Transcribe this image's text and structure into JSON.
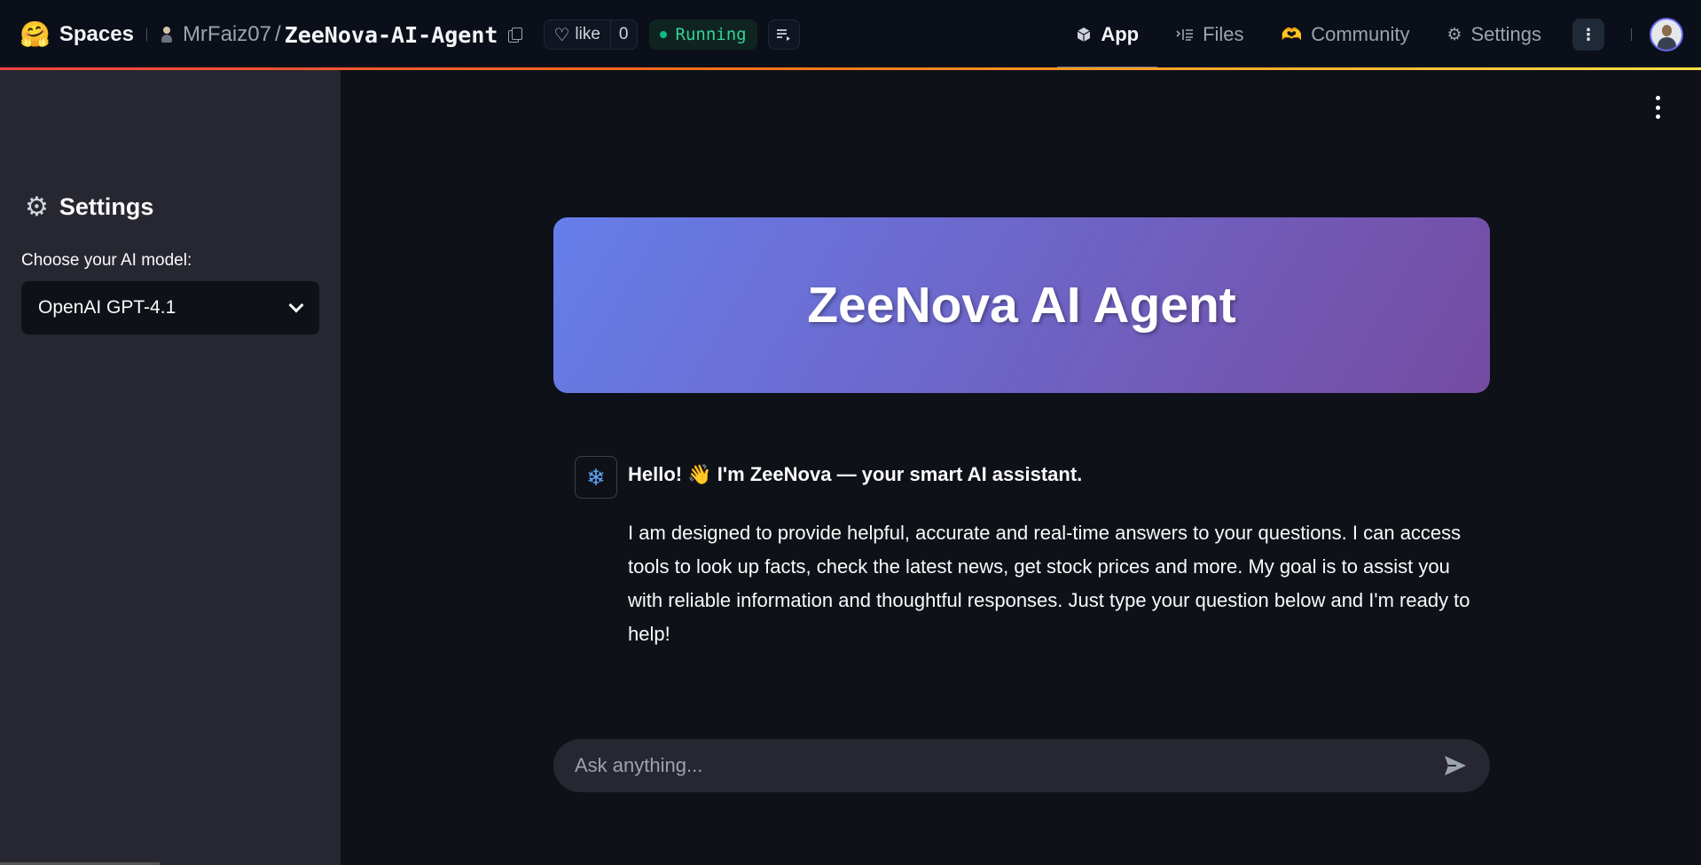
{
  "topbar": {
    "logo_icon": "hugging-face-emoji",
    "spaces_label": "Spaces",
    "owner": "MrFaiz07",
    "separator": "/",
    "repo": "ZeeNova-AI-Agent",
    "like_label": "like",
    "like_count": "0",
    "status": "Running",
    "status_color": "#34d399",
    "tabs": [
      {
        "label": "App",
        "icon": "cube-icon",
        "active": true
      },
      {
        "label": "Files",
        "icon": "files-icon",
        "active": false
      },
      {
        "label": "Community",
        "icon": "community-icon",
        "active": false
      },
      {
        "label": "Settings",
        "icon": "gear-icon",
        "active": false
      }
    ],
    "accent_gradient": [
      "#ef4444",
      "#f97316",
      "#fde047"
    ]
  },
  "sidebar": {
    "title": "Settings",
    "model_label": "Choose your AI model:",
    "model_selected": "OpenAI GPT-4.1"
  },
  "main": {
    "hero_title": "ZeeNova AI Agent",
    "hero_gradient": [
      "#667eea",
      "#764ba2"
    ],
    "message": {
      "avatar_icon": "snowflake-icon",
      "greeting": "Hello! 👋 I'm ZeeNova — your smart AI assistant.",
      "body": "I am designed to provide helpful, accurate and real-time answers to your questions. I can access tools to look up facts, check the latest news, get stock prices and more. My goal is to assist you with reliable information and thoughtful responses. Just type your question below and I'm ready to help!"
    },
    "input_placeholder": "Ask anything..."
  }
}
